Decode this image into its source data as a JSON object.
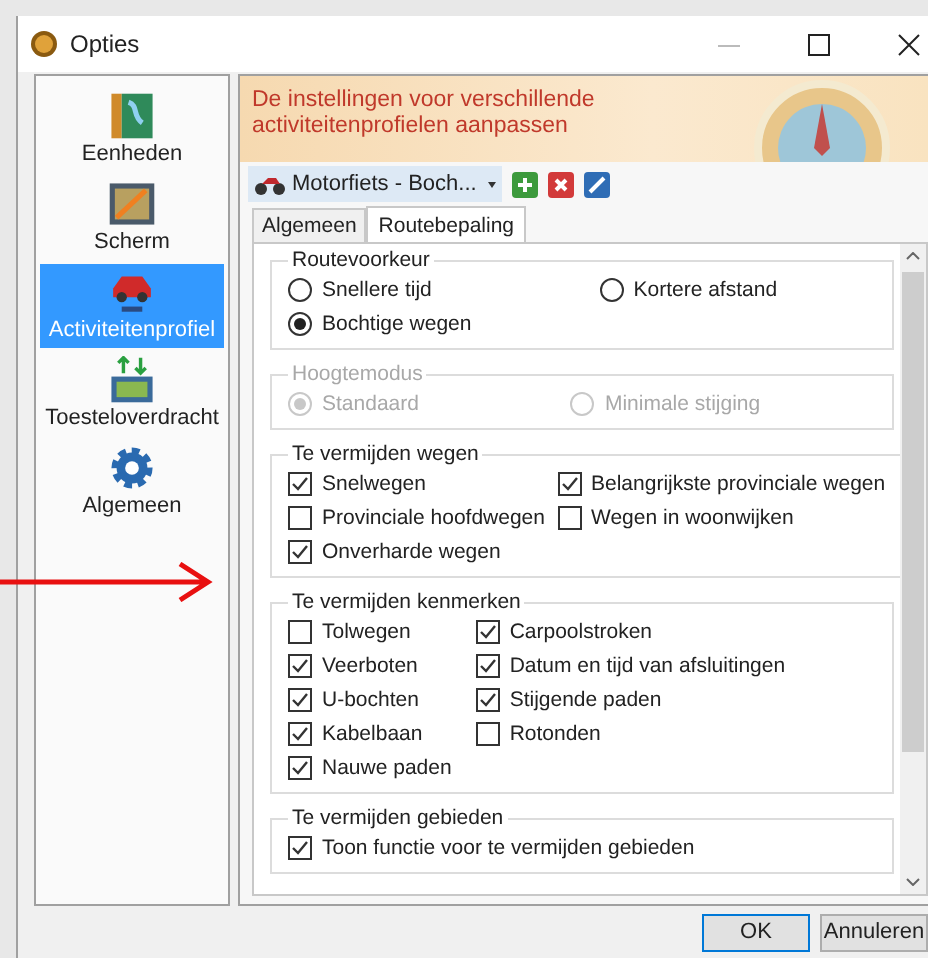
{
  "window": {
    "title": "Opties"
  },
  "sidebar": {
    "items": [
      {
        "label": "Eenheden",
        "selected": false
      },
      {
        "label": "Scherm",
        "selected": false
      },
      {
        "label": "Activiteitenprofiel",
        "selected": true
      },
      {
        "label": "Toesteloverdracht",
        "selected": false
      },
      {
        "label": "Algemeen",
        "selected": false
      }
    ]
  },
  "header": {
    "title": "De instellingen voor verschillende activiteitenprofielen aanpassen"
  },
  "profile": {
    "value": "Motorfiets - Boch..."
  },
  "tabs": [
    {
      "label": "Algemeen",
      "selected": false
    },
    {
      "label": "Routebepaling",
      "selected": true
    }
  ],
  "groups": [
    {
      "title": "Routevoorkeur",
      "kind": "radio",
      "disabled": false,
      "items": [
        {
          "label": "Snellere tijd",
          "selected": false
        },
        {
          "label": "Kortere afstand",
          "selected": false
        },
        {
          "label": "Bochtige wegen",
          "selected": true
        }
      ]
    },
    {
      "title": "Hoogtemodus",
      "kind": "radio",
      "disabled": true,
      "items": [
        {
          "label": "Standaard",
          "selected": true
        },
        {
          "label": "Minimale stijging",
          "selected": false
        }
      ]
    },
    {
      "title": "Te vermijden wegen",
      "kind": "checkbox",
      "disabled": false,
      "items": [
        {
          "label": "Snelwegen",
          "checked": true
        },
        {
          "label": "Belangrijkste provinciale wegen",
          "checked": true
        },
        {
          "label": "Provinciale hoofdwegen",
          "checked": false
        },
        {
          "label": "Wegen in woonwijken",
          "checked": false
        },
        {
          "label": "Onverharde wegen",
          "checked": true
        }
      ]
    },
    {
      "title": "Te vermijden kenmerken",
      "kind": "checkbox",
      "disabled": false,
      "items": [
        {
          "label": "Tolwegen",
          "checked": false
        },
        {
          "label": "Carpoolstroken",
          "checked": true
        },
        {
          "label": "Veerboten",
          "checked": true
        },
        {
          "label": "Datum en tijd van afsluitingen",
          "checked": true
        },
        {
          "label": "U-bochten",
          "checked": true
        },
        {
          "label": "Stijgende paden",
          "checked": true
        },
        {
          "label": "Kabelbaan",
          "checked": true
        },
        {
          "label": "Rotonden",
          "checked": false
        },
        {
          "label": "Nauwe paden",
          "checked": true
        }
      ]
    },
    {
      "title": "Te vermijden gebieden",
      "kind": "checkbox",
      "disabled": false,
      "items": [
        {
          "label": "Toon functie voor te vermijden gebieden",
          "checked": true
        }
      ]
    }
  ],
  "buttons": [
    {
      "label": "OK",
      "default": true
    },
    {
      "label": "Annuleren",
      "default": false
    }
  ]
}
